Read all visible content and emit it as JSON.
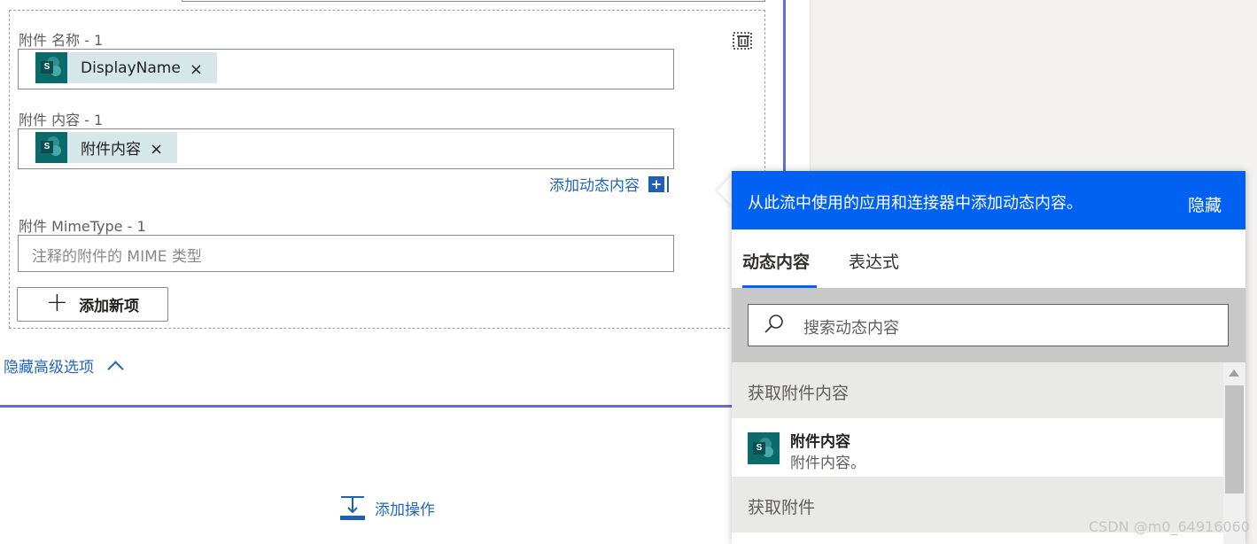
{
  "form": {
    "attachment_name_label": "附件 名称 - 1",
    "attachment_name_token": "DisplayName",
    "attachment_content_label": "附件 内容 - 1",
    "attachment_content_token": "附件内容",
    "token_remove": "×",
    "add_dynamic_content": "添加动态内容",
    "add_dynamic_plus": "+",
    "mimetype_label": "附件 MimeType - 1",
    "mimetype_placeholder": "注释的附件的 MIME 类型",
    "add_new_item": "添加新项",
    "hide_advanced": "隐藏高级选项",
    "sharepoint_glyph": "S"
  },
  "add_action": "添加操作",
  "flyout": {
    "header": "从此流中使用的应用和连接器中添加动态内容。",
    "hide": "隐藏",
    "tabs": [
      {
        "label": "动态内容",
        "active": true
      },
      {
        "label": "表达式",
        "active": false
      }
    ],
    "search_placeholder": "搜索动态内容",
    "groups": [
      {
        "title": "获取附件内容",
        "items": [
          {
            "title": "附件内容",
            "description": "附件内容。"
          }
        ]
      },
      {
        "title": "获取附件",
        "items": []
      }
    ]
  },
  "watermark": "CSDN @m0_64916060",
  "colors": {
    "accent": "#0061f2",
    "link": "#2266c0",
    "card_border": "#6b69d6",
    "sharepoint": "#0b6a6a",
    "token_bg": "#d5e7e8"
  }
}
